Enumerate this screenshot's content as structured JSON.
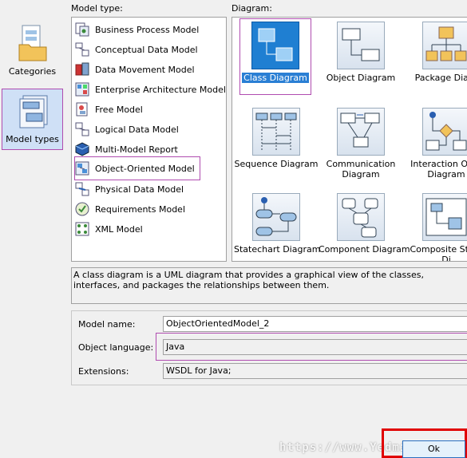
{
  "nav": {
    "categories_label": "Categories",
    "model_types_label": "Model types"
  },
  "headers": {
    "model_type": "Model type:",
    "diagram": "Diagram:"
  },
  "models": [
    {
      "label": "Business Process Model",
      "icon": "business-process-icon"
    },
    {
      "label": "Conceptual Data Model",
      "icon": "conceptual-data-icon"
    },
    {
      "label": "Data Movement Model",
      "icon": "data-movement-icon"
    },
    {
      "label": "Enterprise Architecture Model",
      "icon": "enterprise-architecture-icon"
    },
    {
      "label": "Free Model",
      "icon": "free-model-icon"
    },
    {
      "label": "Logical Data Model",
      "icon": "logical-data-icon"
    },
    {
      "label": "Multi-Model Report",
      "icon": "multi-model-report-icon"
    },
    {
      "label": "Object-Oriented Model",
      "icon": "object-oriented-icon"
    },
    {
      "label": "Physical Data Model",
      "icon": "physical-data-icon"
    },
    {
      "label": "Requirements Model",
      "icon": "requirements-icon"
    },
    {
      "label": "XML Model",
      "icon": "xml-model-icon"
    }
  ],
  "selected_model": "Object-Oriented Model",
  "diagrams": [
    {
      "line1": "Class Diagram",
      "line2": "",
      "icon": "class-diagram-icon"
    },
    {
      "line1": "Object Diagram",
      "line2": "",
      "icon": "object-diagram-icon"
    },
    {
      "line1": "Package Diagr",
      "line2": "",
      "icon": "package-diagram-icon"
    },
    {
      "line1": "Sequence Diagram",
      "line2": "",
      "icon": "sequence-diagram-icon"
    },
    {
      "line1": "Communication",
      "line2": "Diagram",
      "icon": "communication-diagram-icon"
    },
    {
      "line1": "Interaction Over",
      "line2": "Diagram",
      "icon": "interaction-overview-icon"
    },
    {
      "line1": "Statechart Diagram",
      "line2": "",
      "icon": "statechart-diagram-icon"
    },
    {
      "line1": "Component Diagram",
      "line2": "",
      "icon": "component-diagram-icon"
    },
    {
      "line1": "Composite Struc",
      "line2": "Di",
      "icon": "composite-structure-icon"
    }
  ],
  "selected_diagram": "Class Diagram",
  "description": "A class diagram is a UML diagram that provides a graphical view of the classes, interfaces, and packages the relationships between them.",
  "fields": {
    "model_name_label": "Model name:",
    "model_name_value": "ObjectOrientedModel_2",
    "object_language_label": "Object language:",
    "object_language_value": "Java",
    "extensions_label": "Extensions:",
    "extensions_value": "WSDL for Java;"
  },
  "ok_label": "Ok",
  "watermark": "https://www.Yedmin.cc",
  "colors": {
    "highlight_border": "#b04cb0",
    "ok_highlight": "#e00000",
    "selection_blue": "#2a7fd4"
  }
}
